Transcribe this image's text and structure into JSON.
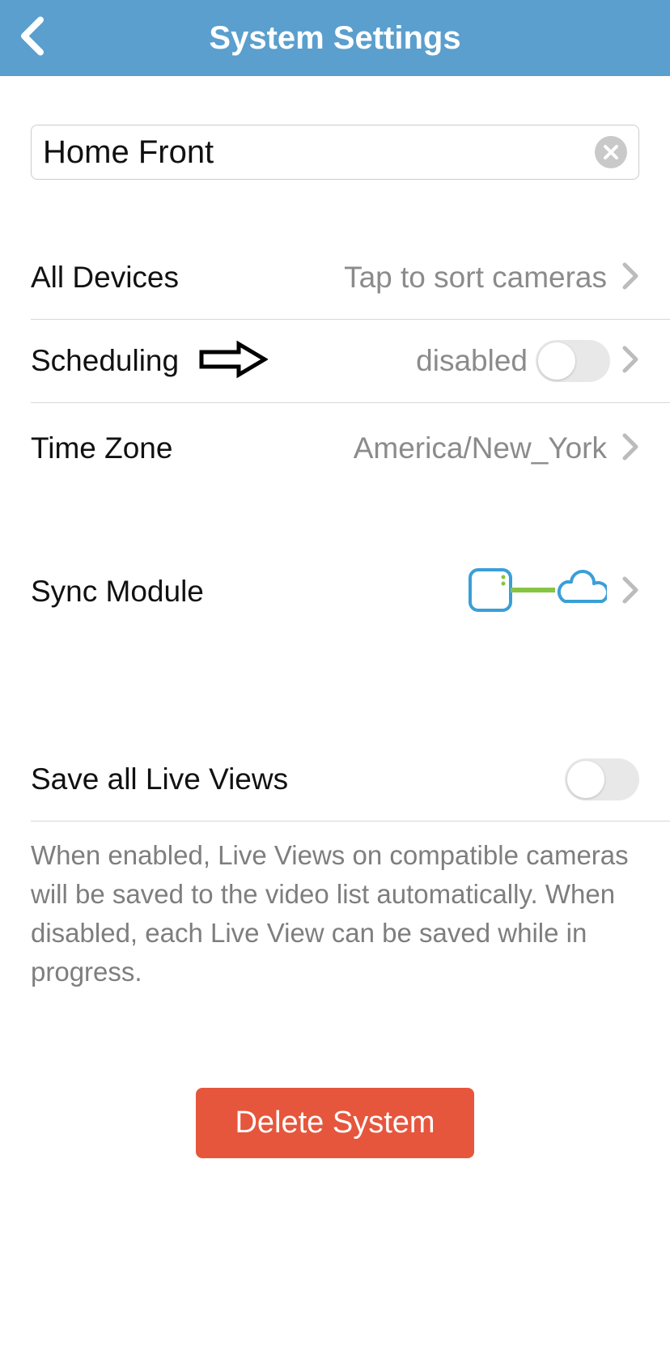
{
  "header": {
    "title": "System Settings"
  },
  "name_input": {
    "value": "Home Front"
  },
  "rows": {
    "all_devices": {
      "label": "All Devices",
      "value": "Tap to sort cameras"
    },
    "scheduling": {
      "label": "Scheduling",
      "value": "disabled"
    },
    "time_zone": {
      "label": "Time Zone",
      "value": "America/New_York"
    },
    "sync_module": {
      "label": "Sync Module"
    },
    "live_views": {
      "label": "Save all Live Views"
    }
  },
  "help": {
    "live_views": "When enabled, Live Views on compatible cameras will be saved to the video list automatically. When disabled, each Live View can be saved while in progress."
  },
  "buttons": {
    "delete": "Delete System"
  }
}
